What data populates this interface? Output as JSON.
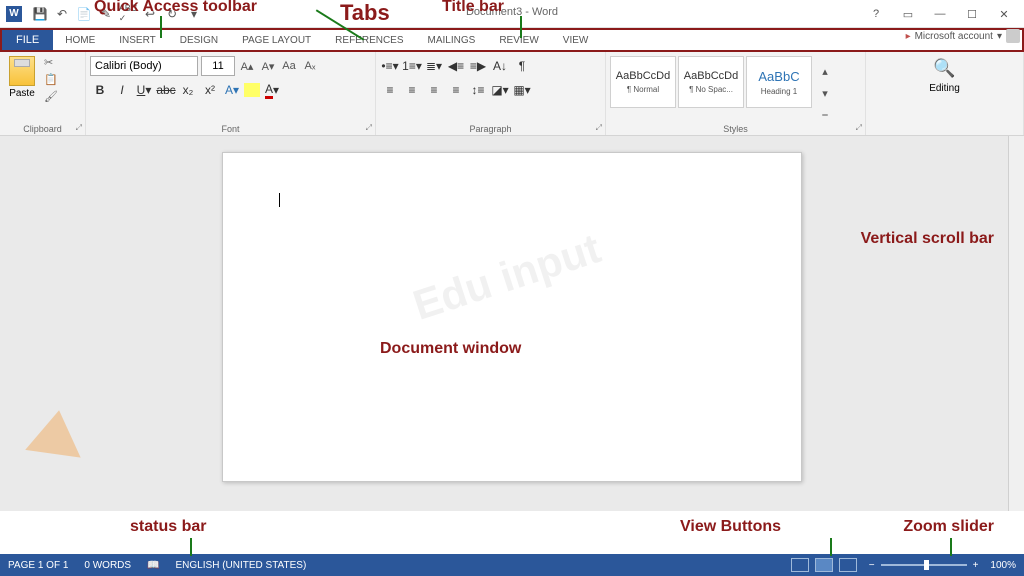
{
  "title": "Document3 - Word",
  "account": "Microsoft account",
  "tabs": {
    "file": "FILE",
    "home": "HOME",
    "insert": "INSERT",
    "design": "DESIGN",
    "layout": "PAGE LAYOUT",
    "refs": "REFERENCES",
    "mail": "MAILINGS",
    "review": "REVIEW",
    "view": "VIEW"
  },
  "font": {
    "name": "Calibri (Body)",
    "size": "11"
  },
  "ribbonGroups": {
    "clipboard": "Clipboard",
    "font": "Font",
    "paragraph": "Paragraph",
    "styles": "Styles",
    "editing": "Editing"
  },
  "paste": "Paste",
  "styles": [
    {
      "preview": "AaBbCcDd",
      "name": "¶ Normal"
    },
    {
      "preview": "AaBbCcDd",
      "name": "¶ No Spac..."
    },
    {
      "preview": "AaBbC",
      "name": "Heading 1"
    }
  ],
  "status": {
    "page": "PAGE 1 OF 1",
    "words": "0 WORDS",
    "lang": "ENGLISH (UNITED STATES)",
    "zoom": "100%"
  },
  "annotations": {
    "qat": "Quick Access toolbar",
    "tabs": "Tabs",
    "title": "Title bar",
    "vscroll": "Vertical scroll bar",
    "docwin": "Document window",
    "status": "status bar",
    "viewbtns": "View Buttons",
    "zoom": "Zoom slider"
  }
}
